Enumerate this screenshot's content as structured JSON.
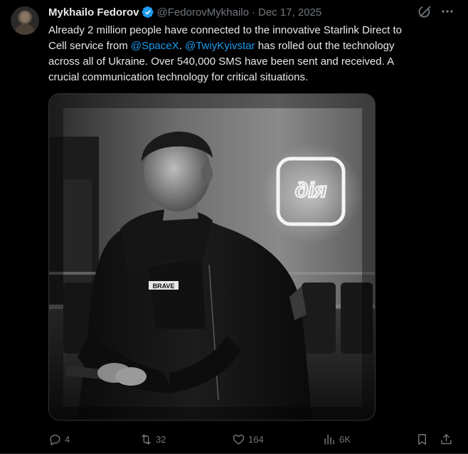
{
  "author": {
    "name": "Mykhailo Fedorov",
    "handle": "@FedorovMykhailo",
    "separator": "·",
    "date": "Dec 17, 2025"
  },
  "text": {
    "line1": "Already 2 million people have connected to the innovative Starlink Direct to",
    "line2_prefix": "Cell service from ",
    "mention1": "@SpaceX",
    "line2_mid": ". ",
    "mention2": "@TwiyKyivstar",
    "line2_suffix": " has rolled out the technology",
    "line3": "across all of Ukraine. Over 540,000 SMS have been sent and received. A",
    "line4": "crucial communication technology for critical situations."
  },
  "image": {
    "sign_text": "дія",
    "shirt_text": "BRAVE"
  },
  "actions": {
    "replies": "4",
    "reposts": "32",
    "likes": "164",
    "views": "6K"
  },
  "colors": {
    "background": "#000000",
    "text": "#e7e9ea",
    "muted": "#71767b",
    "link": "#1d9bf0",
    "verified": "#1d9bf0"
  },
  "icons": [
    "avatar",
    "verified-badge-icon",
    "grok-icon",
    "more-icon",
    "reply-icon",
    "repost-icon",
    "like-icon",
    "views-icon",
    "bookmark-icon",
    "share-icon"
  ]
}
